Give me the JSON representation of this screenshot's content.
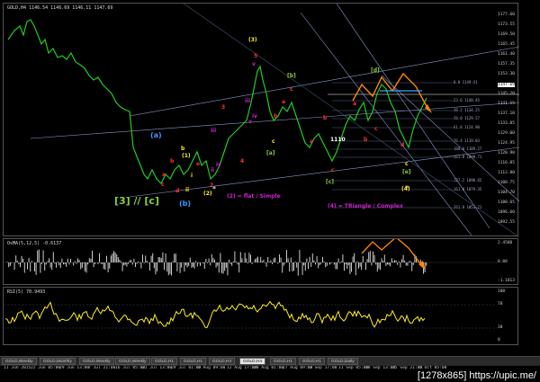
{
  "main_header": "GOLD,H4  1146.54 1146.69 1146.11 1147.69",
  "osma_header": "OsMA(5,12,5) -0.6137",
  "rsi_header": "RSI(5) 70.9493",
  "price_ticks": [
    "1177.60",
    "1173.55",
    "1169.50",
    "1165.45",
    "1161.40",
    "1157.35",
    "1153.30",
    "1149.25",
    "1145.20",
    "1141.15",
    "1137.10",
    "1133.05",
    "1129.00",
    "1124.95",
    "1120.90",
    "1116.85",
    "1112.80",
    "1108.75",
    "1104.70",
    "1100.65",
    "1096.60",
    "1092.55"
  ],
  "price_ticks_extra": [
    "1147.69"
  ],
  "osma_ticks": [
    "2.4580",
    "0.00",
    "-1.1813"
  ],
  "rsi_ticks": [
    "100",
    "70",
    "30",
    "0"
  ],
  "time_ticks": [
    "11 Jun 2015",
    "22 Jun 05:00",
    "29 Jun 13:00",
    "7 Jul 21:00",
    "16 Jul 05:00",
    "21 Jul 13:00",
    "29 Jul 01:00",
    "5 Aug 09:00",
    "12 Aug 17:00",
    "20 Aug 01:00",
    "27 Aug 09:00",
    "3 Sep 17:00",
    "11 Sep 05:00",
    "18 Sep 13:00",
    "25 Sep 21:00",
    "5 Oct 05:00"
  ],
  "tabs": [
    "GOLD,Weekly",
    "GOLD,Monthly",
    "GOLD,Weekly",
    "GOLD,Weekly",
    "GOLD,H1",
    "GOLD,H1",
    "GOLD,H4",
    "GOLD,H4",
    "GOLD,H1",
    "GOLD,H1",
    "GOLD,Daily"
  ],
  "active_tab": 7,
  "annotations": {
    "a_paren_blue": "(a)",
    "b_paren_blue": "(b)",
    "three_bracket_c": "[3] // [c]",
    "one_paren": "(1)",
    "two_paren": "(2)",
    "three_paren": "(3)",
    "four_paren": "(4)",
    "b_bracket": "[b]",
    "a_bracket": "[a]",
    "c_bracket": "[c]",
    "d_bracket": "[d]",
    "e_bracket": "[e]",
    "flat_note": "(2) = flat / Simple",
    "triangle_note": "(4) = TRiangle / Complex",
    "price_1110": "1110",
    "b_small": "b",
    "e_small": "e",
    "c_small": "c",
    "d_small": "d",
    "a_small": "a",
    "iii": "iii",
    "iv": "iv",
    "v": "v",
    "i": "i",
    "ii": "ii",
    "five": "5",
    "four": "4",
    "three": "3",
    "one": "1",
    "two": "2"
  },
  "fib_levels": [
    "0.0 1149.41",
    "23.6 1140.45",
    "38.2 1134.25",
    "50.0 1129.57",
    "61.8 1124.90",
    "76.4 1119.03",
    "100.0 1109.27",
    "161.8 1098.71",
    "127.2 1090.65",
    "161.8 1079.35",
    "261.8 1053.21"
  ],
  "signature": "[1278x865] https://upic.me/",
  "colors": {
    "candle": "#22cc22",
    "yellow": "#ffee22",
    "orange": "#ff8800",
    "magenta": "#cc22cc",
    "blue": "#3399ff",
    "red": "#ff3333",
    "green_label": "#88cc44"
  }
}
